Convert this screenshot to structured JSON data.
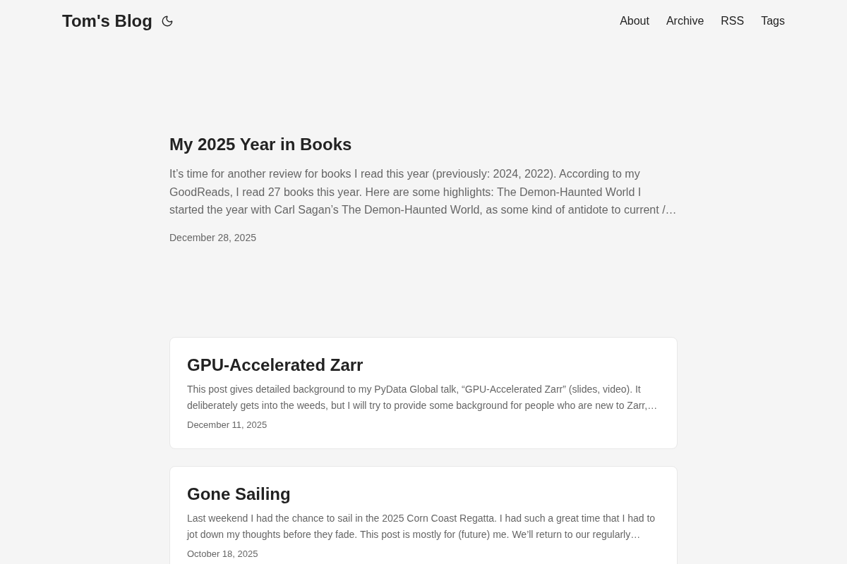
{
  "header": {
    "site_title": "Tom's Blog",
    "nav": [
      "About",
      "Archive",
      "RSS",
      "Tags"
    ]
  },
  "posts": [
    {
      "kind": "featured",
      "title": "My 2025 Year in Books",
      "excerpt": "It’s time for another review for books I read this year (previously: 2024, 2022). According to my GoodReads, I read 27 books this year. Here are some highlights: The Demon-Haunted World I started the year with Carl Sagan’s The Demon-Haunted World, as some kind of antidote to current /…",
      "date": "December 28, 2025"
    },
    {
      "kind": "card",
      "title": "GPU-Accelerated Zarr",
      "excerpt": "This post gives detailed background to my PyData Global talk, “GPU-Accelerated Zarr” (slides, video). It deliberately gets into the weeds, but I will try to provide some background for people who are new to Zarr,…",
      "date": "December 11, 2025"
    },
    {
      "kind": "card",
      "title": "Gone Sailing",
      "excerpt": "Last weekend I had the chance to sail in the 2025 Corn Coast Regatta. I had such a great time that I had to jot down my thoughts before they fade. This post is mostly for (future) me. We’ll return to our regularly…",
      "date": "October 18, 2025"
    }
  ]
}
